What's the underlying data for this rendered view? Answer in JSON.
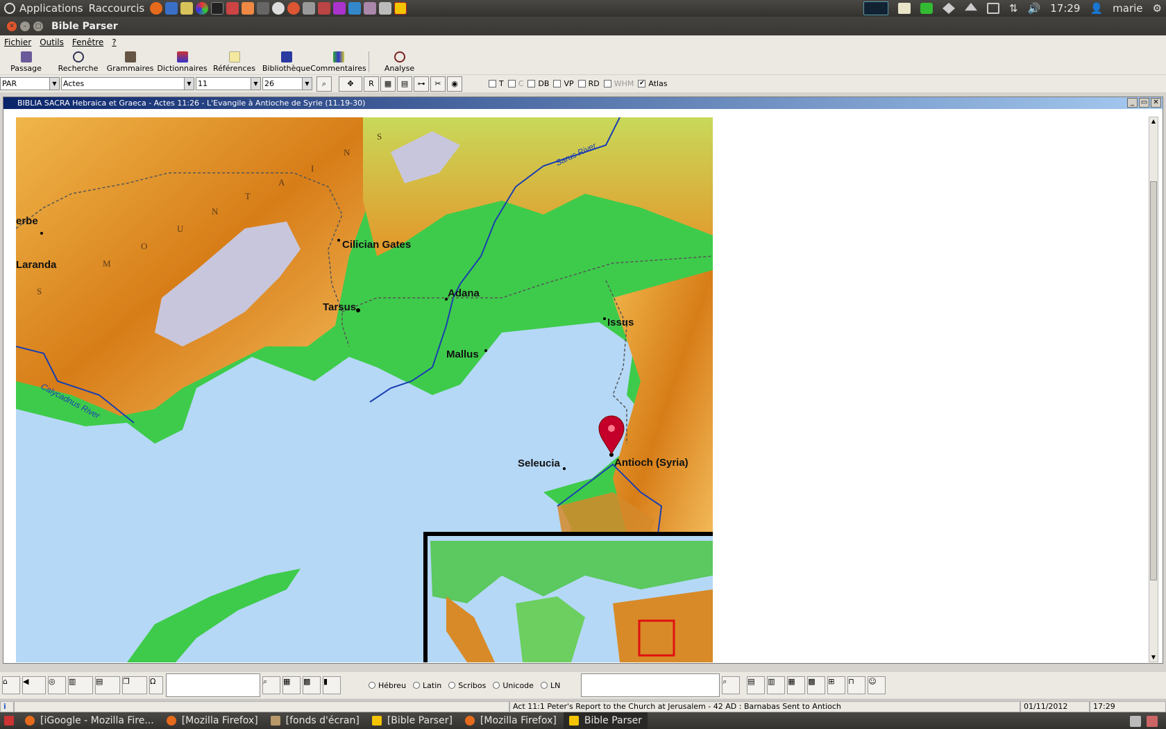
{
  "topbar": {
    "menus": [
      "Applications",
      "Raccourcis"
    ],
    "time": "17:29",
    "user": "marie"
  },
  "window": {
    "title": "Bible Parser"
  },
  "menubar": [
    "Fichier",
    "Outils",
    "Fenêtre",
    "?"
  ],
  "toolbar": [
    "Passage",
    "Recherche",
    "Grammaires",
    "Dictionnaires",
    "Références",
    "Bibliothèque",
    "Commentaires",
    "Analyse"
  ],
  "selectors": {
    "version": "PAR",
    "book": "Actes",
    "chapter": "11",
    "verse": "26",
    "r_button": "R"
  },
  "options": [
    {
      "label": "T",
      "checked": false,
      "enabled": true
    },
    {
      "label": "C",
      "checked": false,
      "enabled": false
    },
    {
      "label": "DB",
      "checked": false,
      "enabled": true
    },
    {
      "label": "VP",
      "checked": false,
      "enabled": true
    },
    {
      "label": "RD",
      "checked": false,
      "enabled": true
    },
    {
      "label": "WHM",
      "checked": false,
      "enabled": false
    },
    {
      "label": "Atlas",
      "checked": true,
      "enabled": true
    }
  ],
  "document": {
    "title": "BIBLIA SACRA Hebraica et Graeca - Actes 11:26 - L'Evangile à Antioche de Syrie (11.19-30)"
  },
  "map": {
    "places": [
      "erbe",
      "Laranda",
      "Cilician Gates",
      "Tarsus",
      "Adana",
      "Issus",
      "Mallus",
      "Seleucia",
      "Antioch (Syria)"
    ],
    "rivers": [
      "Sarus River",
      "Calycadnus River"
    ],
    "mountain_letters": [
      "S",
      "M",
      "O",
      "U",
      "N",
      "T",
      "A",
      "I",
      "N",
      "S"
    ]
  },
  "bottom": {
    "radios": [
      "Hébreu",
      "Latin",
      "Scribos",
      "Unicode",
      "LN"
    ]
  },
  "status": {
    "info": "i",
    "text": "Act 11:1 Peter's Report to the Church at Jerusalem - 42 AD : Barnabas Sent to Antioch",
    "date": "01/11/2012",
    "time": "17:29"
  },
  "taskbar": [
    "[iGoogle - Mozilla Fire...",
    "[Mozilla Firefox]",
    "[fonds d'écran]",
    "[Bible Parser]",
    "[Mozilla Firefox]",
    "Bible Parser"
  ],
  "colors": {
    "sea": "#b5d8f7",
    "lowland": "#3ecb4b",
    "highland": "#e08a1a",
    "snow": "#c8c6dc",
    "river": "#1a3fb0",
    "marker": "#c4002a"
  }
}
